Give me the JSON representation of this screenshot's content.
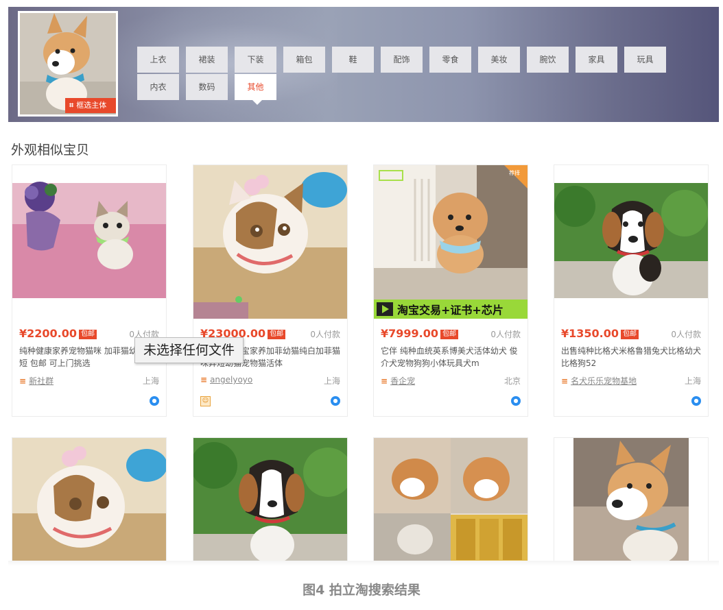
{
  "header": {
    "crop_badge_label": "框选主体",
    "categories": [
      "上衣",
      "裙装",
      "下装",
      "箱包",
      "鞋",
      "配饰",
      "零食",
      "美妆",
      "腕饮",
      "家具",
      "玩具",
      "内衣",
      "数码",
      "其他"
    ],
    "active_category": "其他"
  },
  "section_title": "外观相似宝贝",
  "products": [
    {
      "price": "¥2200.00",
      "tag": "包邮",
      "paid": "0人付款",
      "desc": "纯种健康家养宠物猫咪 加菲猫幼猫 异短 包邮 可上门挑选",
      "seller": "新社群",
      "location": "上海"
    },
    {
      "price": "¥23000.00",
      "tag": "包邮",
      "paid": "0人付款",
      "desc": "日本宠物宝宝家养加菲幼猫纯白加菲猫咪异短幼猫宠物猫活体",
      "seller": "angelyoyo",
      "location": "上海"
    },
    {
      "price": "¥7999.00",
      "tag": "包邮",
      "paid": "0人付款",
      "desc": "它伴 纯种血统英系博美犬活体幼犬 俊介犬宠物狗狗小体玩具犬m",
      "seller": "香企宠",
      "location": "北京",
      "image_banner": "淘宝交易+证书+芯片",
      "corner_label": "荐择"
    },
    {
      "price": "¥1350.00",
      "tag": "包邮",
      "paid": "0人付款",
      "desc": "出售纯种比格犬米格鲁猎兔犬比格幼犬比格狗52",
      "seller": "名犬乐乐宠物基地",
      "location": "上海"
    }
  ],
  "tooltip_text": "未选择任何文件",
  "caption": "图4 拍立淘搜索结果",
  "colors": {
    "accent": "#e8492b",
    "blue": "#2a8ef0"
  }
}
